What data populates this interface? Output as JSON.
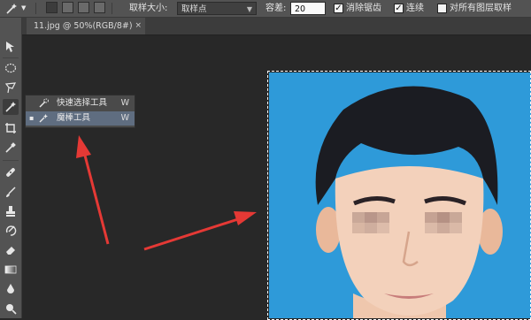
{
  "options_bar": {
    "sample_size_label": "取样大小:",
    "sample_size_value": "取样点",
    "tolerance_label": "容差:",
    "tolerance_value": "20",
    "anti_alias": {
      "label": "消除锯齿",
      "checked": true
    },
    "contiguous": {
      "label": "连续",
      "checked": true
    },
    "sample_all_layers": {
      "label": "对所有图层取样",
      "checked": false
    },
    "check_glyph": "✓"
  },
  "document_tab": {
    "title": "11.jpg @ 50%(RGB/8#)",
    "close_glyph": "×"
  },
  "toolbar": {
    "tools": [
      "move-icon",
      "marquee-icon",
      "lasso-icon",
      "magic-wand-icon",
      "crop-icon",
      "eyedropper-icon",
      "healing-brush-icon",
      "brush-icon",
      "clone-stamp-icon",
      "history-brush-icon",
      "eraser-icon",
      "gradient-icon",
      "blur-icon",
      "dodge-icon"
    ],
    "active_tool": "magic-wand-icon"
  },
  "tool_flyout": {
    "items": [
      {
        "label": "快速选择工具",
        "shortcut": "W",
        "icon": "quick-selection-icon",
        "selected": false
      },
      {
        "label": "魔棒工具",
        "shortcut": "W",
        "icon": "magic-wand-icon",
        "selected": true
      }
    ],
    "selected_marker": "▪"
  },
  "colors": {
    "canvas_background": "#2e9ad9",
    "annotation_arrow": "#e53935",
    "selection_highlight": "#5f6d80",
    "panel": "#535353",
    "workspace": "#282828"
  }
}
